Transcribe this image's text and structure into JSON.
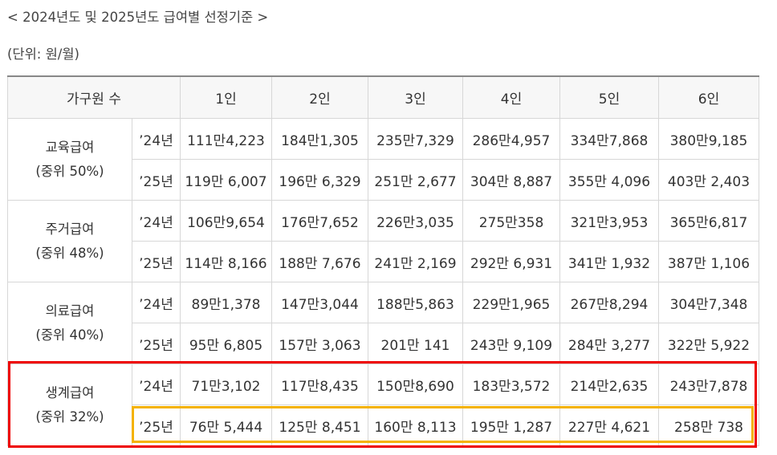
{
  "heading": "< 2024년도 및 2025년도 급여별 선정기준 >",
  "unit_note": "(단위: 원/월)",
  "table": {
    "header": {
      "household_label": "가구원 수",
      "columns": [
        "1인",
        "2인",
        "3인",
        "4인",
        "5인",
        "6인"
      ]
    },
    "groups": [
      {
        "name": "교육급여",
        "criterion": "(중위 50%)",
        "rows": [
          {
            "year": "’24년",
            "values": [
              "111만4,223",
              "184만1,305",
              "235만7,329",
              "286만4,957",
              "334만7,868",
              "380만9,185"
            ]
          },
          {
            "year": "’25년",
            "values": [
              "119만 6,007",
              "196만 6,329",
              "251만 2,677",
              "304만 8,887",
              "355만 4,096",
              "403만 2,403"
            ]
          }
        ]
      },
      {
        "name": "주거급여",
        "criterion": "(중위 48%)",
        "rows": [
          {
            "year": "’24년",
            "values": [
              "106만9,654",
              "176만7,652",
              "226만3,035",
              "275만358",
              "321만3,953",
              "365만6,817"
            ]
          },
          {
            "year": "’25년",
            "values": [
              "114만 8,166",
              "188만 7,676",
              "241만 2,169",
              "292만 6,931",
              "341만 1,932",
              "387만 1,106"
            ]
          }
        ]
      },
      {
        "name": "의료급여",
        "criterion": "(중위 40%)",
        "rows": [
          {
            "year": "’24년",
            "values": [
              "89만1,378",
              "147만3,044",
              "188만5,863",
              "229만1,965",
              "267만8,294",
              "304만7,348"
            ]
          },
          {
            "year": "’25년",
            "values": [
              "95만 6,805",
              "157만 3,063",
              "201만 141",
              "243만 9,109",
              "284만 3,277",
              "322만 5,922"
            ]
          }
        ]
      },
      {
        "name": "생계급여",
        "criterion": "(중위 32%)",
        "rows": [
          {
            "year": "’24년",
            "values": [
              "71만3,102",
              "117만8,435",
              "150만8,690",
              "183만3,572",
              "214만2,635",
              "243만7,878"
            ]
          },
          {
            "year": "’25년",
            "values": [
              "76만 5,444",
              "125만 8,451",
              "160만 8,113",
              "195만 1,287",
              "227만 4,621",
              "258만 738"
            ]
          }
        ]
      }
    ]
  },
  "highlights": {
    "red_box_color": "#ee0000",
    "yellow_box_color": "#f4b200"
  }
}
